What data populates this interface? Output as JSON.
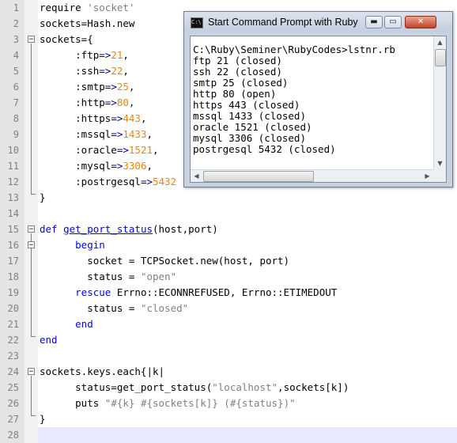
{
  "editor": {
    "line_numbers": [
      "1",
      "2",
      "3",
      "4",
      "5",
      "6",
      "7",
      "8",
      "9",
      "10",
      "11",
      "12",
      "13",
      "14",
      "15",
      "16",
      "17",
      "18",
      "19",
      "20",
      "21",
      "22",
      "23",
      "24",
      "25",
      "26",
      "27",
      "28"
    ],
    "lines": [
      "require 'socket'",
      "sockets=Hash.new",
      "sockets={",
      "      :ftp=>21,",
      "      :ssh=>22,",
      "      :smtp=>25,",
      "      :http=>80,",
      "      :https=>443,",
      "      :mssql=>1433,",
      "      :oracle=>1521,",
      "      :mysql=>3306,",
      "      :postrgesql=>5432",
      "}",
      "",
      "def get_port_status(host,port)",
      "      begin",
      "        socket = TCPSocket.new(host, port)",
      "        status = \"open\"",
      "      rescue Errno::ECONNREFUSED, Errno::ETIMEDOUT",
      "        status = \"closed\"",
      "      end",
      "end",
      "",
      "sockets.keys.each{|k|",
      "      status=get_port_status(\"localhost\",sockets[k])",
      "      puts \"#{k} #{sockets[k]} (#{status})\"",
      "}",
      ""
    ]
  },
  "console": {
    "title": "Start Command Prompt with Ruby",
    "icon_label": "C:\\",
    "buttons": {
      "minimize": "▬",
      "maximize": "▭",
      "close": "✕"
    },
    "output": [
      "C:\\Ruby\\Seminer\\RubyCodes>lstnr.rb",
      "ftp 21 (closed)",
      "ssh 22 (closed)",
      "smtp 25 (closed)",
      "http 80 (open)",
      "https 443 (closed)",
      "mssql 1433 (closed)",
      "oracle 1521 (closed)",
      "mysql 3306 (closed)",
      "postrgesql 5432 (closed)"
    ],
    "scroll_arrows": {
      "up": "▲",
      "down": "▼",
      "left": "◀",
      "right": "▶"
    }
  }
}
